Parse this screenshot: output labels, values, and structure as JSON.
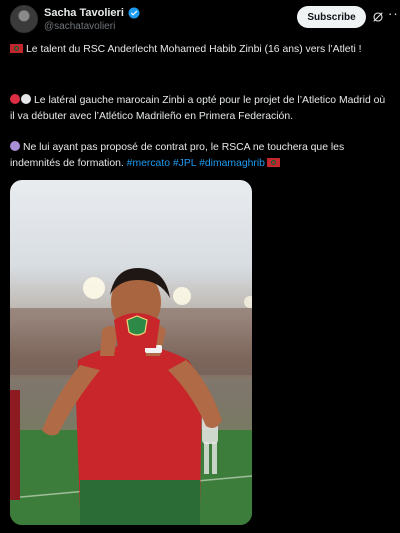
{
  "author": {
    "name": "Sacha Tavolieri",
    "handle": "@sachatavolieri"
  },
  "actions": {
    "subscribe_label": "Subscribe",
    "more_label": "···"
  },
  "post": {
    "p1": "Le talent du RSC Anderlecht Mohamed Habib Zinbi (16 ans) vers l’Atleti !",
    "p2": "Le latéral gauche marocain Zinbi a opté pour le projet de l’Atletico Madrid où il va débuter avec l’Atlético Madrileño en Primera Federación.",
    "p3_text": "Ne lui ayant pas proposé de contrat pro, le RSCA ne touchera que les indemnités de formation. ",
    "hashtags": [
      "#mercato",
      "#JPL",
      "#dimamaghrib"
    ]
  },
  "icons": {
    "verified": "verified-badge-icon",
    "grok": "grok-icon",
    "more": "more-icon",
    "flag": "morocco-flag-icon",
    "dots": [
      "red-circle-icon",
      "white-circle-icon",
      "purple-circle-icon"
    ]
  },
  "colors": {
    "accent": "#1d9bf0",
    "background": "#000000",
    "text": "#e7e9ea",
    "muted": "#71767b"
  }
}
